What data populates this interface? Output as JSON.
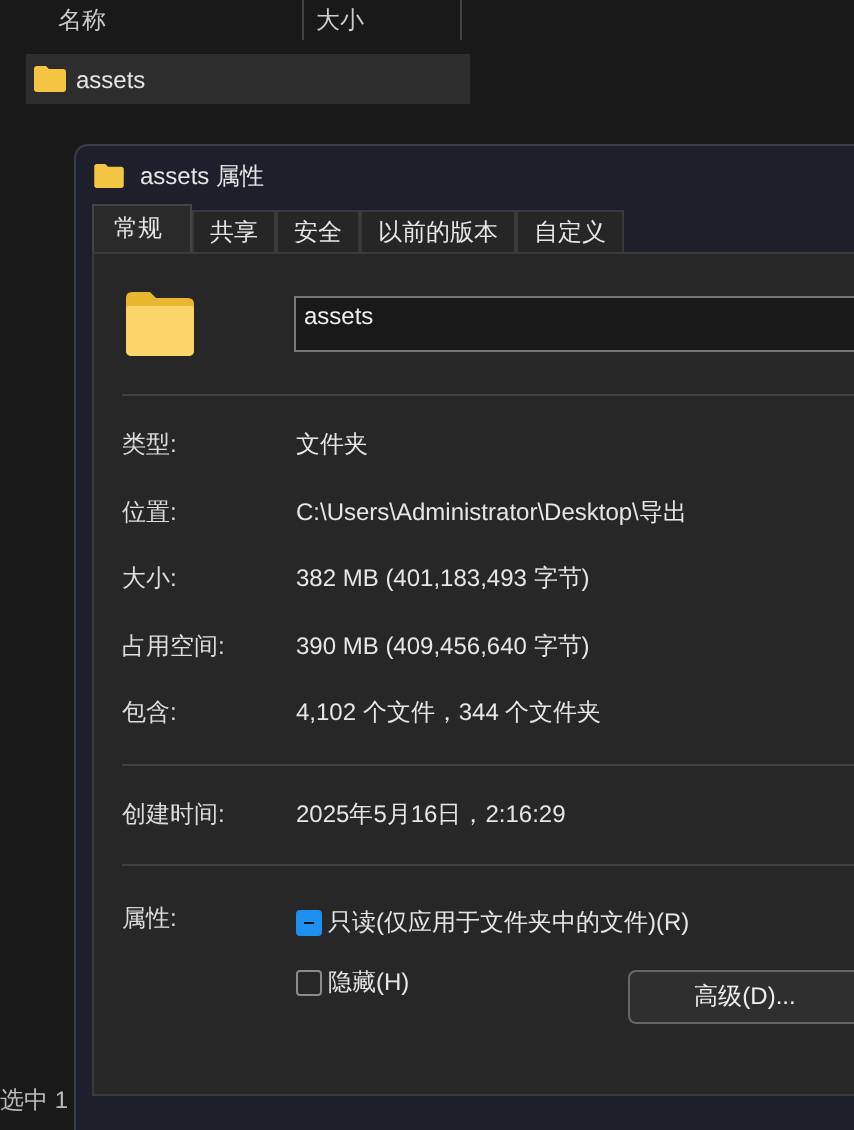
{
  "explorer": {
    "columns": [
      "名称",
      "大小"
    ],
    "items": [
      {
        "name": "assets",
        "selected": true
      }
    ],
    "status_bar": "选中 1"
  },
  "dialog": {
    "title": "assets 属性",
    "tabs": [
      {
        "label": "常规",
        "selected": true
      },
      {
        "label": "共享",
        "selected": false
      },
      {
        "label": "安全",
        "selected": false
      },
      {
        "label": "以前的版本",
        "selected": false
      },
      {
        "label": "自定义",
        "selected": false
      }
    ],
    "name_field": {
      "value": "assets"
    },
    "info_groups": [
      [
        {
          "label": "类型:",
          "value": "文件夹"
        },
        {
          "label": "位置:",
          "value": "C:\\Users\\Administrator\\Desktop\\导出"
        },
        {
          "label": "大小:",
          "value": "382 MB (401,183,493 字节)"
        },
        {
          "label": "占用空间:",
          "value": "390 MB (409,456,640 字节)"
        },
        {
          "label": "包含:",
          "value": "4,102 个文件，344 个文件夹"
        }
      ],
      [
        {
          "label": "创建时间:",
          "value": "2025年5月16日，2:16:29"
        }
      ]
    ],
    "attributes": {
      "label": "属性:",
      "checkboxes": [
        {
          "label": "只读(仅应用于文件夹中的文件)(R)",
          "checked": true,
          "mixed": true
        },
        {
          "label": "隐藏(H)",
          "checked": false,
          "mixed": false
        }
      ],
      "advanced_button": "高级(D)..."
    }
  }
}
